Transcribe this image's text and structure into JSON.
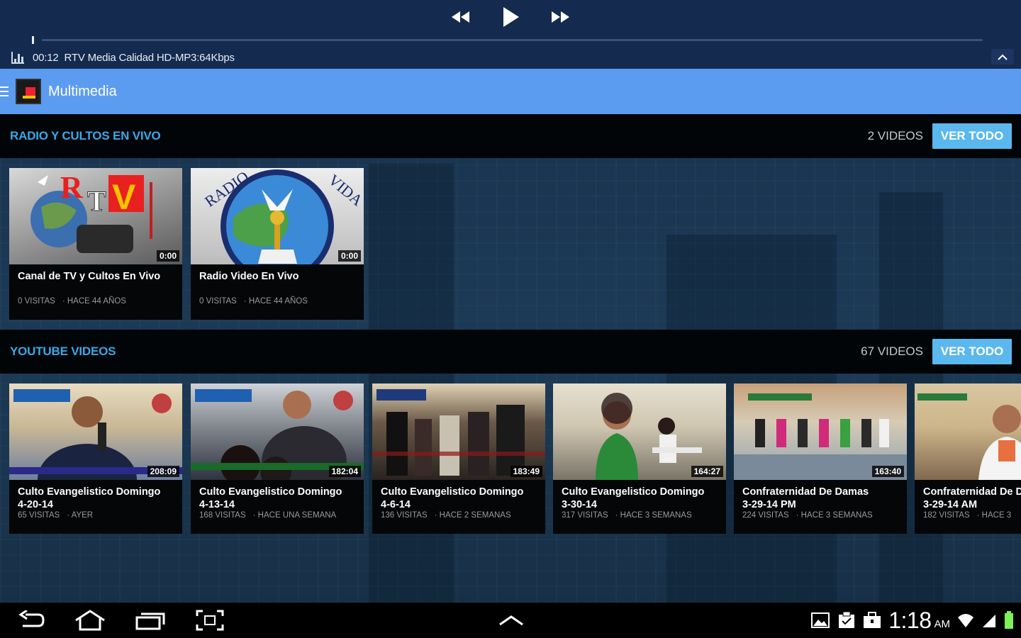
{
  "player": {
    "elapsed": "00:12",
    "track": "RTV Media Calidad HD-MP3:64Kbps",
    "progress_fraction": 0.0
  },
  "appbar": {
    "title": "Multimedia"
  },
  "sections": [
    {
      "title": "RADIO Y CULTOS EN VIVO",
      "count": "2 VIDEOS",
      "action": "VER TODO",
      "videos": [
        {
          "title": "Canal de TV y Cultos En Vivo",
          "duration": "0:00",
          "views": "0 VISITAS",
          "age": "· HACE 44 AÑOS"
        },
        {
          "title": "Radio Video En Vivo",
          "duration": "0:00",
          "views": "0 VISITAS",
          "age": "· HACE 44 AÑOS"
        }
      ]
    },
    {
      "title": "YOUTUBE VIDEOS",
      "count": "67 VIDEOS",
      "action": "VER TODO",
      "videos": [
        {
          "title": "Culto Evangelistico Domingo\n4-20-14",
          "duration": "208:09",
          "views": "65 VISITAS",
          "age": "· AYER"
        },
        {
          "title": "Culto Evangelistico Domingo\n4-13-14",
          "duration": "182:04",
          "views": "168 VISITAS",
          "age": "· HACE UNA SEMANA"
        },
        {
          "title": "Culto Evangelistico Domingo\n4-6-14",
          "duration": "183:49",
          "views": "136 VISITAS",
          "age": "· HACE 2 SEMANAS"
        },
        {
          "title": "Culto Evangelistico Domingo\n3-30-14",
          "duration": "164:27",
          "views": "317 VISITAS",
          "age": "· HACE 3 SEMANAS"
        },
        {
          "title": "Confraternidad De Damas\n3-29-14 PM",
          "duration": "163:40",
          "views": "224 VISITAS",
          "age": "· HACE 3 SEMANAS"
        },
        {
          "title": "Confraternidad De D\n3-29-14 AM",
          "duration": "",
          "views": "182 VISITAS",
          "age": "· HACE 3"
        }
      ]
    }
  ],
  "status": {
    "time": "1:18",
    "ampm": "AM"
  },
  "icons": {
    "player": [
      "rewind-icon",
      "play-icon",
      "fast-forward-icon",
      "equalizer-icon",
      "chevron-up-icon"
    ],
    "nav": [
      "back-icon",
      "home-icon",
      "recent-apps-icon",
      "screenshot-icon",
      "nav-up-chevron-icon"
    ],
    "status": [
      "gallery-notification-icon",
      "clipboard-notification-icon",
      "briefcase-notification-icon",
      "wifi-icon",
      "signal-icon",
      "battery-icon"
    ]
  },
  "colors": {
    "player_bg": "#142a4e",
    "appbar_bg": "#5b9cf0",
    "section_title": "#3aa8e8",
    "button_bg": "#5bb8ee",
    "battery": "#7ef05a"
  }
}
